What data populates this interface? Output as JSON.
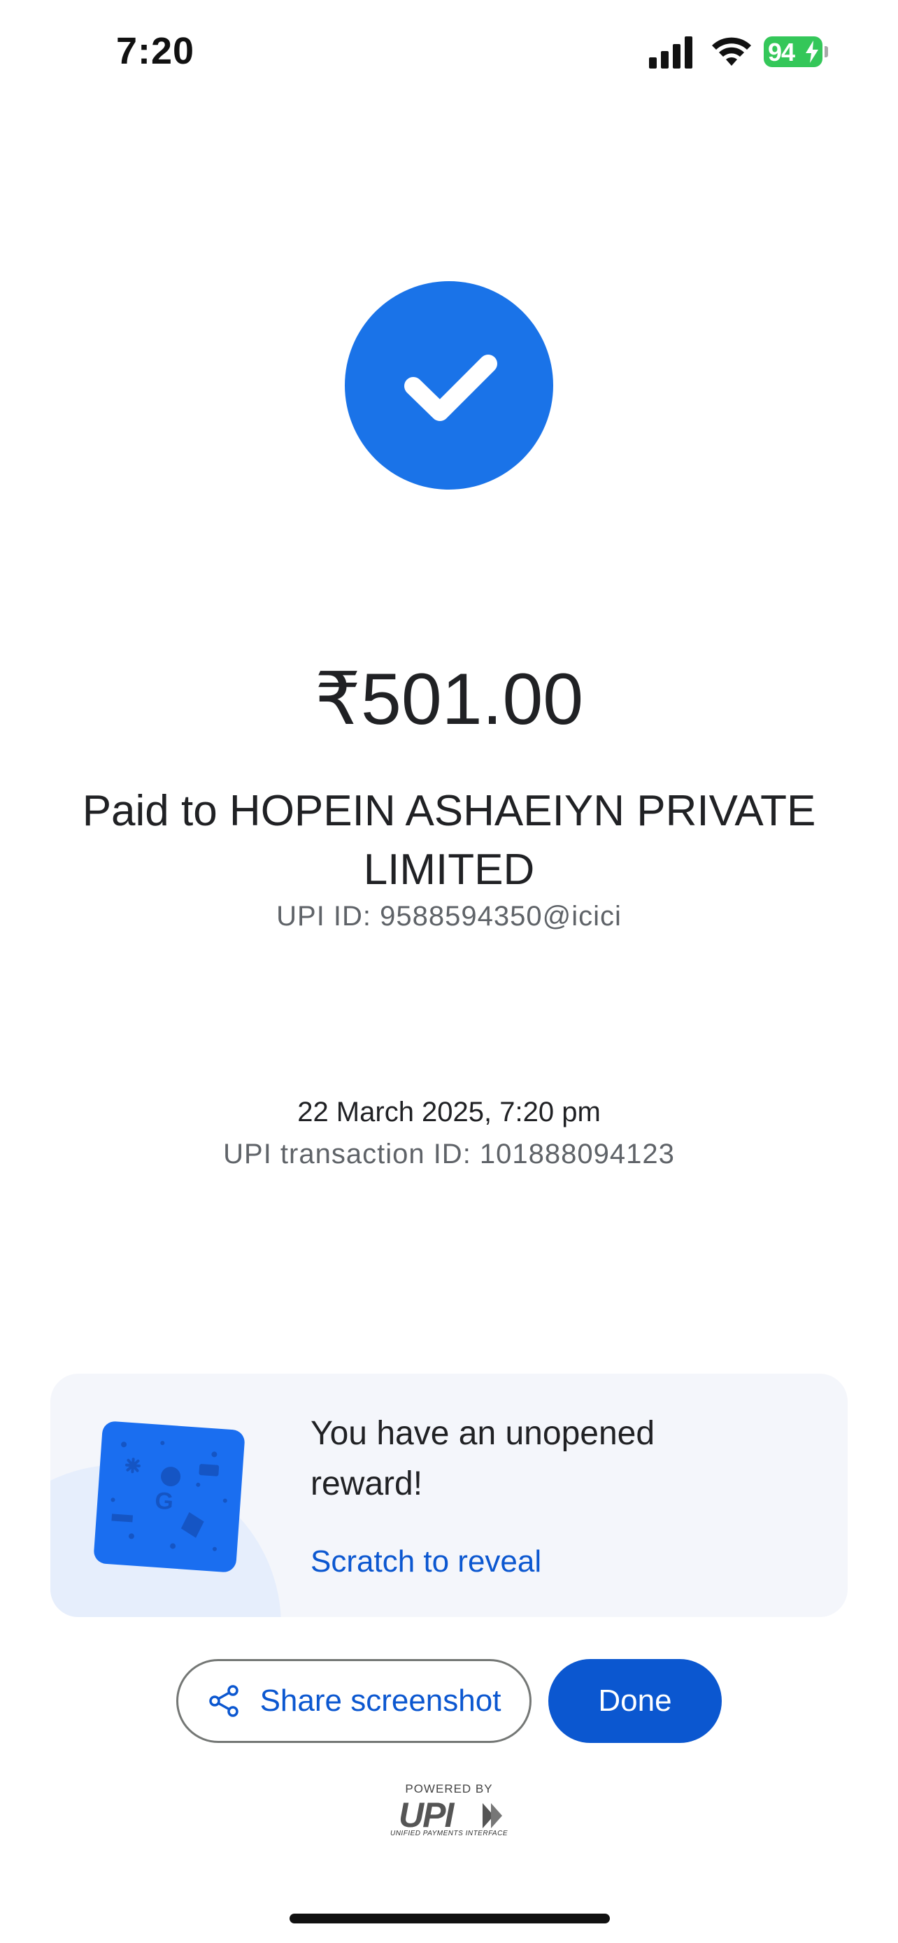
{
  "status_bar": {
    "time": "7:20",
    "battery": "94",
    "icons": [
      "signal-icon",
      "wifi-icon",
      "battery-charging-icon"
    ],
    "battery_color": "#34c759"
  },
  "payment": {
    "status_icon": "check-icon",
    "amount": "₹501.00",
    "payee": "Paid to HOPEIN ASHAEIYN PRIVATE LIMITED",
    "upi_id": "UPI ID: 9588594350@icici",
    "datetime": "22 March 2025, 7:20 pm",
    "transaction_id": "UPI transaction ID: 101888094123"
  },
  "reward": {
    "title": "You have an unopened reward!",
    "link": "Scratch to reveal",
    "icon": "scratch-card-icon"
  },
  "actions": {
    "share_label": "Share screenshot",
    "share_icon": "share-icon",
    "done_label": "Done"
  },
  "footer": {
    "powered_by": "POWERED BY",
    "upi_subtitle": "UNIFIED PAYMENTS INTERFACE"
  },
  "colors": {
    "accent": "#1a73e8",
    "primary_button": "#0b57d0",
    "link": "#0b57d0"
  }
}
